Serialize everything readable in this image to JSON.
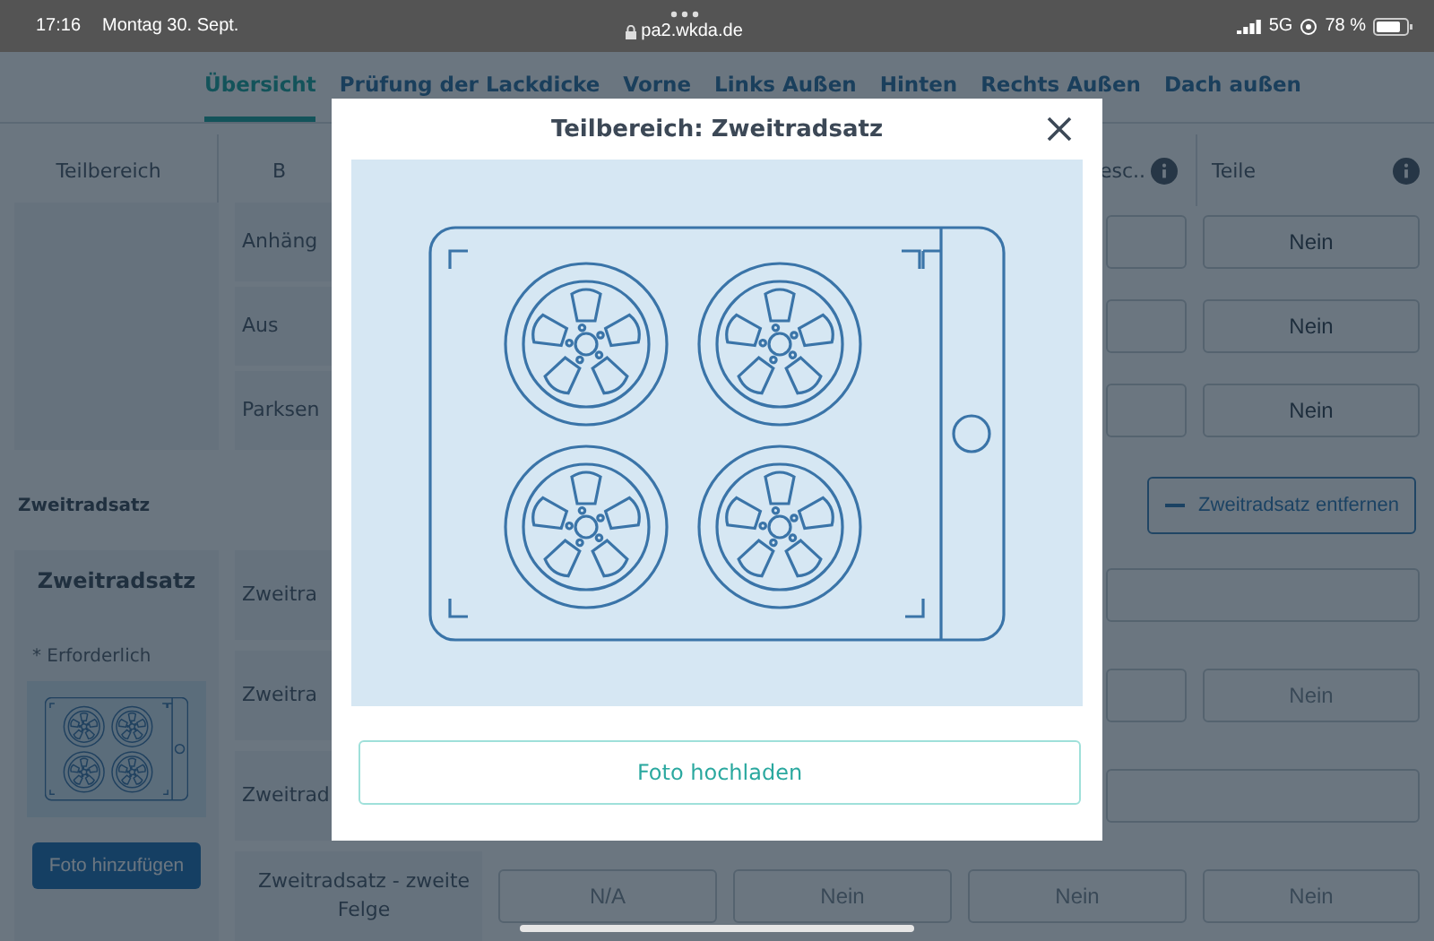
{
  "status_bar": {
    "time": "17:16",
    "date": "Montag 30. Sept.",
    "url": "pa2.wkda.de",
    "network": "5G",
    "battery": "78 %"
  },
  "tabs": [
    {
      "label": "Übersicht",
      "selected": true
    },
    {
      "label": "Prüfung der Lackdicke",
      "selected": false
    },
    {
      "label": "Vorne",
      "selected": false
    },
    {
      "label": "Links Außen",
      "selected": false
    },
    {
      "label": "Hinten",
      "selected": false
    },
    {
      "label": "Rechts Außen",
      "selected": false
    },
    {
      "label": "Dach außen",
      "selected": false
    }
  ],
  "table": {
    "columns": [
      {
        "label": "Teilbereich",
        "info": false
      },
      {
        "label": "B",
        "info": false
      },
      {
        "label": "esc..",
        "info": true
      },
      {
        "label": "Teile",
        "info": true
      }
    ],
    "rows": [
      {
        "label": "Anhäng",
        "kind": "choices",
        "cells": [
          {
            "kind": "empty"
          },
          {
            "kind": "empty"
          },
          {
            "kind": "empty"
          },
          {
            "kind": "choice",
            "value": "Nein",
            "disabled": false
          }
        ]
      },
      {
        "label": "Aus",
        "kind": "choices",
        "cells": [
          {
            "kind": "empty"
          },
          {
            "kind": "empty"
          },
          {
            "kind": "empty"
          },
          {
            "kind": "choice",
            "value": "Nein",
            "disabled": false
          }
        ]
      },
      {
        "label": "Parksen",
        "kind": "choices",
        "cells": [
          {
            "kind": "empty"
          },
          {
            "kind": "empty"
          },
          {
            "kind": "empty"
          },
          {
            "kind": "choice",
            "value": "Nein",
            "disabled": false
          }
        ]
      }
    ]
  },
  "section": {
    "title": "Zweitradsatz",
    "remove_button": "Zweitradsatz entfernen",
    "card": {
      "title": "Zweitradsatz",
      "required_note": "* Erforderlich",
      "add_photo_button": "Foto hinzufügen"
    },
    "rows": [
      {
        "label": "Zweitra",
        "kind": "text_field"
      },
      {
        "label": "Zweitra",
        "kind": "choices",
        "cells": [
          {
            "kind": "empty"
          },
          {
            "kind": "empty"
          },
          {
            "kind": "empty"
          },
          {
            "kind": "choice",
            "value": "Nein",
            "disabled": true
          }
        ]
      },
      {
        "label": "Zweitrad",
        "kind": "text_field"
      },
      {
        "label": "Zweitradsatz - zweite Felge",
        "kind": "choices",
        "cells": [
          {
            "kind": "choice",
            "value": "N/A",
            "disabled": true
          },
          {
            "kind": "choice",
            "value": "Nein",
            "disabled": true
          },
          {
            "kind": "choice",
            "value": "Nein",
            "disabled": true
          },
          {
            "kind": "choice",
            "value": "Nein",
            "disabled": true
          }
        ]
      }
    ]
  },
  "modal": {
    "title": "Teilbereich: Zweitradsatz",
    "upload_button": "Foto hochladen"
  }
}
